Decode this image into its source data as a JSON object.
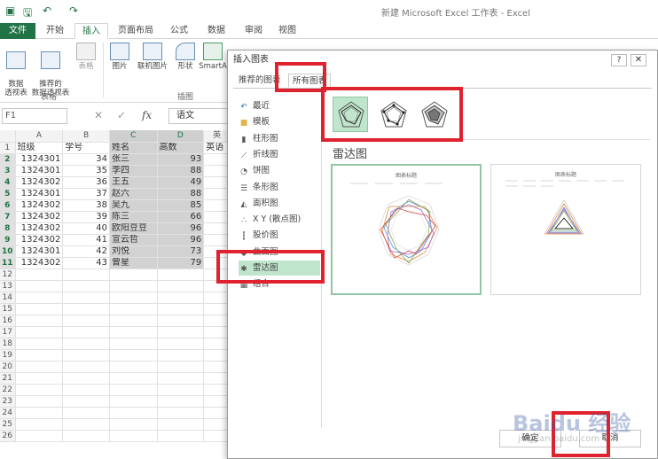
{
  "window": {
    "title": "新建 Microsoft Excel 工作表 - Excel"
  },
  "ribbon_tabs": [
    "文件",
    "开始",
    "插入",
    "页面布局",
    "公式",
    "数据",
    "审阅",
    "视图"
  ],
  "ribbon": {
    "buttons": {
      "pivot": "数据\n透视表",
      "recommended_pivot": "推荐的\n数据透视表",
      "table": "表格",
      "picture": "图片",
      "online_picture": "联机图片",
      "shapes": "形状",
      "smartart": "SmartA"
    },
    "groups": {
      "tables": "表格",
      "illustrations": "插图"
    }
  },
  "formula_bar": {
    "name_box": "F1",
    "fx": "fx",
    "value": "语文"
  },
  "grid": {
    "col_headers": [
      "A",
      "B",
      "C",
      "D",
      "英"
    ],
    "rows": [
      [
        "1",
        "班级",
        "学号",
        "姓名",
        "高数",
        "英语"
      ],
      [
        "2",
        "1324301",
        "34",
        "张三",
        "93",
        ""
      ],
      [
        "3",
        "1324301",
        "35",
        "李四",
        "88",
        ""
      ],
      [
        "4",
        "1324302",
        "36",
        "王五",
        "49",
        ""
      ],
      [
        "5",
        "1324301",
        "37",
        "赵六",
        "88",
        ""
      ],
      [
        "6",
        "1324302",
        "38",
        "吴九",
        "85",
        ""
      ],
      [
        "7",
        "1324302",
        "39",
        "陈三",
        "66",
        ""
      ],
      [
        "8",
        "1324302",
        "40",
        "欧阳豆豆",
        "96",
        ""
      ],
      [
        "9",
        "1324302",
        "41",
        "宣云哲",
        "96",
        ""
      ],
      [
        "10",
        "1324301",
        "42",
        "刘悦",
        "73",
        ""
      ],
      [
        "11",
        "1324302",
        "43",
        "曾星",
        "79",
        ""
      ],
      [
        "12",
        "",
        "",
        "",
        "",
        ""
      ],
      [
        "13",
        "",
        "",
        "",
        "",
        ""
      ],
      [
        "14",
        "",
        "",
        "",
        "",
        ""
      ],
      [
        "15",
        "",
        "",
        "",
        "",
        ""
      ],
      [
        "16",
        "",
        "",
        "",
        "",
        ""
      ],
      [
        "17",
        "",
        "",
        "",
        "",
        ""
      ],
      [
        "18",
        "",
        "",
        "",
        "",
        ""
      ],
      [
        "19",
        "",
        "",
        "",
        "",
        ""
      ],
      [
        "20",
        "",
        "",
        "",
        "",
        ""
      ],
      [
        "21",
        "",
        "",
        "",
        "",
        ""
      ],
      [
        "22",
        "",
        "",
        "",
        "",
        ""
      ],
      [
        "23",
        "",
        "",
        "",
        "",
        ""
      ],
      [
        "24",
        "",
        "",
        "",
        "",
        ""
      ],
      [
        "25",
        "",
        "",
        "",
        "",
        ""
      ],
      [
        "26",
        "",
        "",
        "",
        "",
        ""
      ]
    ]
  },
  "dialog": {
    "title": "插入图表",
    "help": "?",
    "close": "✕",
    "tabs": [
      "推荐的图表",
      "所有图表"
    ],
    "chart_types": [
      {
        "label": "最近",
        "icon": "recent-icon"
      },
      {
        "label": "模板",
        "icon": "folder-icon"
      },
      {
        "label": "柱形图",
        "icon": "column-chart-icon"
      },
      {
        "label": "折线图",
        "icon": "line-chart-icon"
      },
      {
        "label": "饼图",
        "icon": "pie-chart-icon"
      },
      {
        "label": "条形图",
        "icon": "bar-chart-icon"
      },
      {
        "label": "面积图",
        "icon": "area-chart-icon"
      },
      {
        "label": "X Y (散点图)",
        "icon": "scatter-chart-icon"
      },
      {
        "label": "股价图",
        "icon": "stock-chart-icon"
      },
      {
        "label": "曲面图",
        "icon": "surface-chart-icon"
      },
      {
        "label": "雷达图",
        "icon": "radar-chart-icon"
      },
      {
        "label": "组合",
        "icon": "combo-chart-icon"
      }
    ],
    "selected_type": "雷达图",
    "subtype_heading": "雷达图",
    "preview_title": "图表标题",
    "ok": "确定",
    "cancel": "取消"
  },
  "colors": {
    "excel_green": "#217346",
    "annotation_red": "#e0212e",
    "selection_green": "#bfe6cc"
  },
  "watermark": {
    "brand": "Baidu 经验",
    "url": "jingyan.baidu.com"
  }
}
